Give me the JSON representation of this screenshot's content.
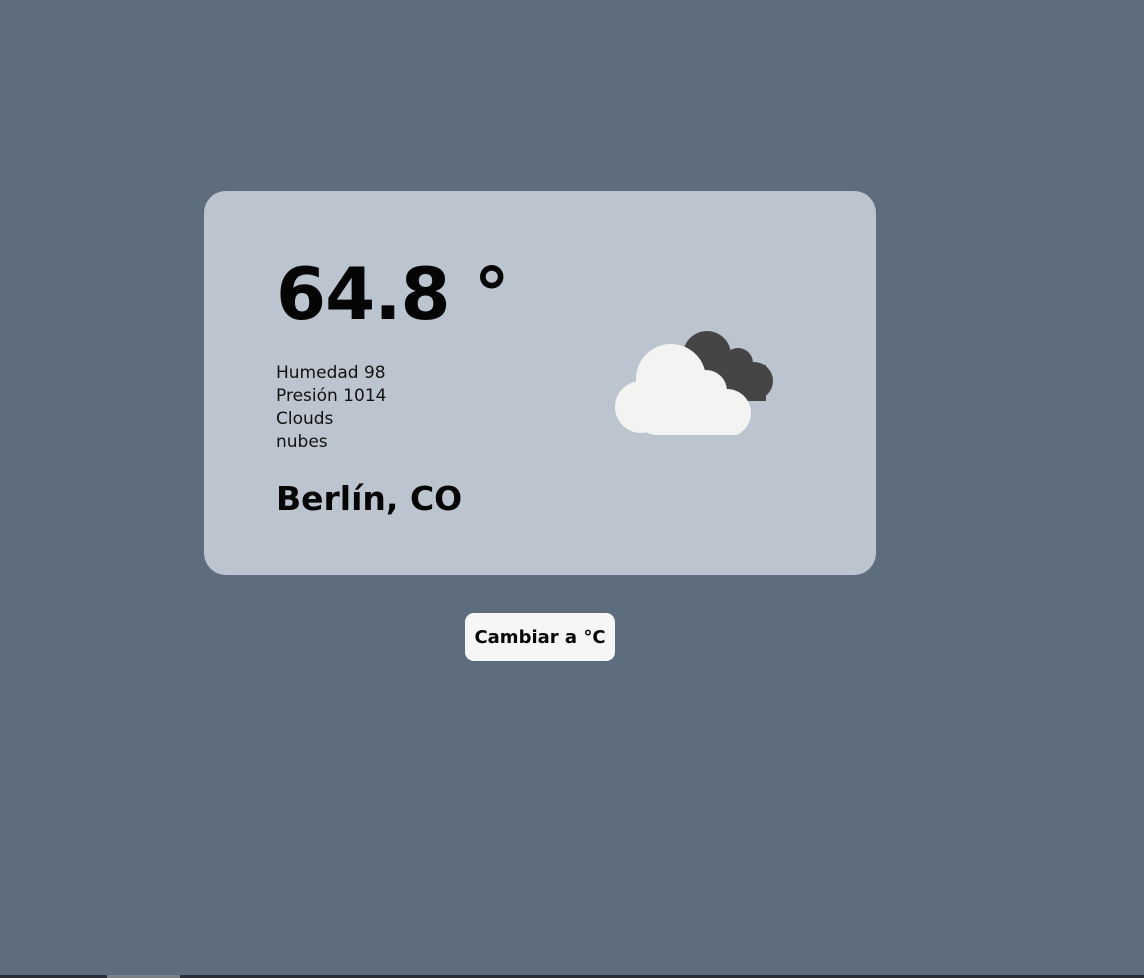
{
  "weather": {
    "temperature": "64.8 °",
    "humidity": "Humedad 98",
    "pressure": "Presión 1014",
    "condition_main": "Clouds",
    "condition_description": "nubes",
    "location": "Berlín, CO",
    "icon": "broken-clouds-icon"
  },
  "controls": {
    "toggle_unit_label": "Cambiar a °C"
  },
  "colors": {
    "page_background": "#5e6d7e",
    "card_background": "#bcc5cf",
    "button_background": "#f6f6f6",
    "cloud_front": "#f3f3f1",
    "cloud_back": "#454545"
  }
}
